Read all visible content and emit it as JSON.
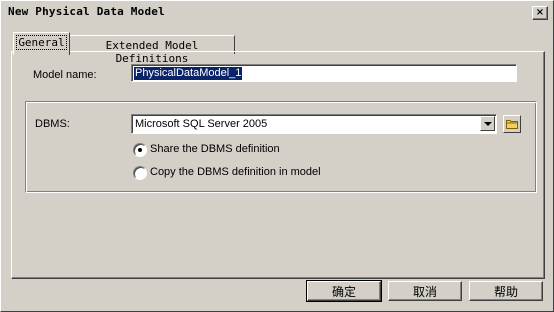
{
  "window": {
    "title": "New Physical Data Model",
    "close_icon": "×"
  },
  "tabs": [
    {
      "label": "General",
      "active": true
    },
    {
      "label": "Extended Model Definitions",
      "active": false
    }
  ],
  "form": {
    "model_name_label": "Model name:",
    "model_name_value": "PhysicalDataModel_1",
    "dbms_label": "DBMS:",
    "dbms_value": "Microsoft SQL Server 2005",
    "browse_icon": "folder-icon",
    "radio_options": [
      {
        "label": "Share the DBMS definition",
        "checked": true
      },
      {
        "label": "Copy the DBMS definition in model",
        "checked": false
      }
    ]
  },
  "buttons": {
    "ok": "确定",
    "cancel": "取消",
    "help": "帮助"
  },
  "colors": {
    "face": "#d4d0c8",
    "selection": "#0a246a"
  }
}
